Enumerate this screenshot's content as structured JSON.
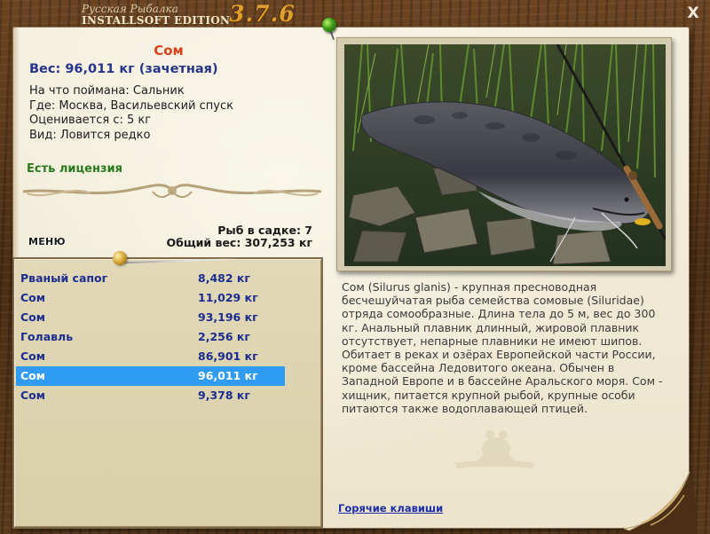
{
  "app": {
    "title_line1": "Русская Рыбалка",
    "title_line2": "INSTALLSOFT EDITION",
    "version": "3.7.6",
    "close_label": "X"
  },
  "fish": {
    "name": "Сом",
    "weight": "Вес: 96,011 кг (зачетная)",
    "bait": "На что поймана: Сальник",
    "location": "Где: Москва, Васильевский спуск",
    "rated_from": "Оценивается с: 5 кг",
    "species_note": "Вид: Ловится редко",
    "license": "Есть лицензия",
    "description": "Сом (Silurus glanis) - крупная пресноводная бесчешуйчатая рыба семейства сомовые (Siluridae) отряда сомообразные. Длина тела до 5 м, вес до 300 кг. Анальный плавник длинный, жировой плавник отсутствует, непарные плавники не имеют шипов. Обитает в реках и озёрах Европейской части России, кроме бассейна Ледовитого океана. Обычен в Западной Европе и в бассейне Аральского моря. Сом - хищник, питается крупной рыбой, крупные особи питаются также водоплавающей птицей."
  },
  "basket": {
    "count": "Рыб в садке: 7",
    "total": "Общий вес: 307,253 кг"
  },
  "menu_label": "МЕНЮ",
  "catch_list": [
    {
      "name": "Рваный сапог",
      "weight": "8,482 кг",
      "selected": false
    },
    {
      "name": "Сом",
      "weight": "11,029 кг",
      "selected": false
    },
    {
      "name": "Сом",
      "weight": "93,196 кг",
      "selected": false
    },
    {
      "name": "Голавль",
      "weight": "2,256 кг",
      "selected": false
    },
    {
      "name": "Сом",
      "weight": "86,901 кг",
      "selected": false
    },
    {
      "name": "Сом",
      "weight": "96,011 кг",
      "selected": true
    },
    {
      "name": "Сом",
      "weight": "9,378 кг",
      "selected": false
    }
  ],
  "hotkeys_label": "Горячие клавиши",
  "colors": {
    "fish_name": "#d8431e",
    "weight": "#27348a",
    "license": "#2a7a1e",
    "list_text": "#1b2d8e",
    "selection": "#2f9cf2",
    "version": "#e0a02e"
  }
}
